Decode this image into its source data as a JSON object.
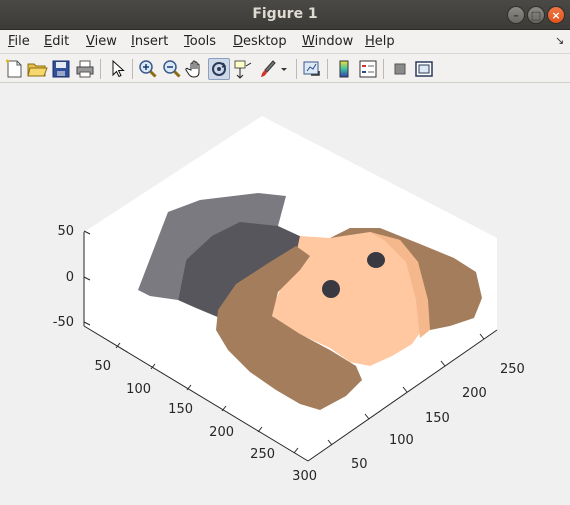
{
  "window": {
    "title": "Figure 1"
  },
  "window_controls": {
    "minimize": "–",
    "maximize": "□",
    "close": "×"
  },
  "menu": [
    {
      "accel": "F",
      "rest": "ile"
    },
    {
      "accel": "E",
      "rest": "dit"
    },
    {
      "accel": "V",
      "rest": "iew"
    },
    {
      "accel": "I",
      "rest": "nsert"
    },
    {
      "accel": "T",
      "rest": "ools"
    },
    {
      "accel": "D",
      "rest": "esktop"
    },
    {
      "accel": "W",
      "rest": "indow"
    },
    {
      "accel": "H",
      "rest": "elp"
    }
  ],
  "menu_dock_arrow": "↘",
  "toolbar": {
    "icons": [
      "new-figure-icon",
      "open-file-icon",
      "save-icon",
      "print-icon",
      "select-arrow-icon",
      "zoom-in-icon",
      "zoom-out-icon",
      "pan-hand-icon",
      "rotate-3d-icon",
      "data-cursor-icon",
      "brush-icon",
      "link-plot-icon",
      "colorbar-icon",
      "legend-icon",
      "hide-plot-tools-icon",
      "show-plot-tools-icon"
    ],
    "active": "rotate-3d-icon"
  },
  "axes": {
    "z_ticks": [
      "50",
      "0",
      "-50"
    ],
    "y_ticks": [
      "50",
      "100",
      "150",
      "200",
      "250",
      "300"
    ],
    "x_ticks": [
      "250",
      "200",
      "150",
      "100",
      "50"
    ]
  },
  "colors": {
    "skin": "#ffc8a0",
    "hair": "#a47e5c",
    "shirt": "#56565c",
    "shirt_light": "#7a7a80",
    "eye": "#3a3840"
  }
}
